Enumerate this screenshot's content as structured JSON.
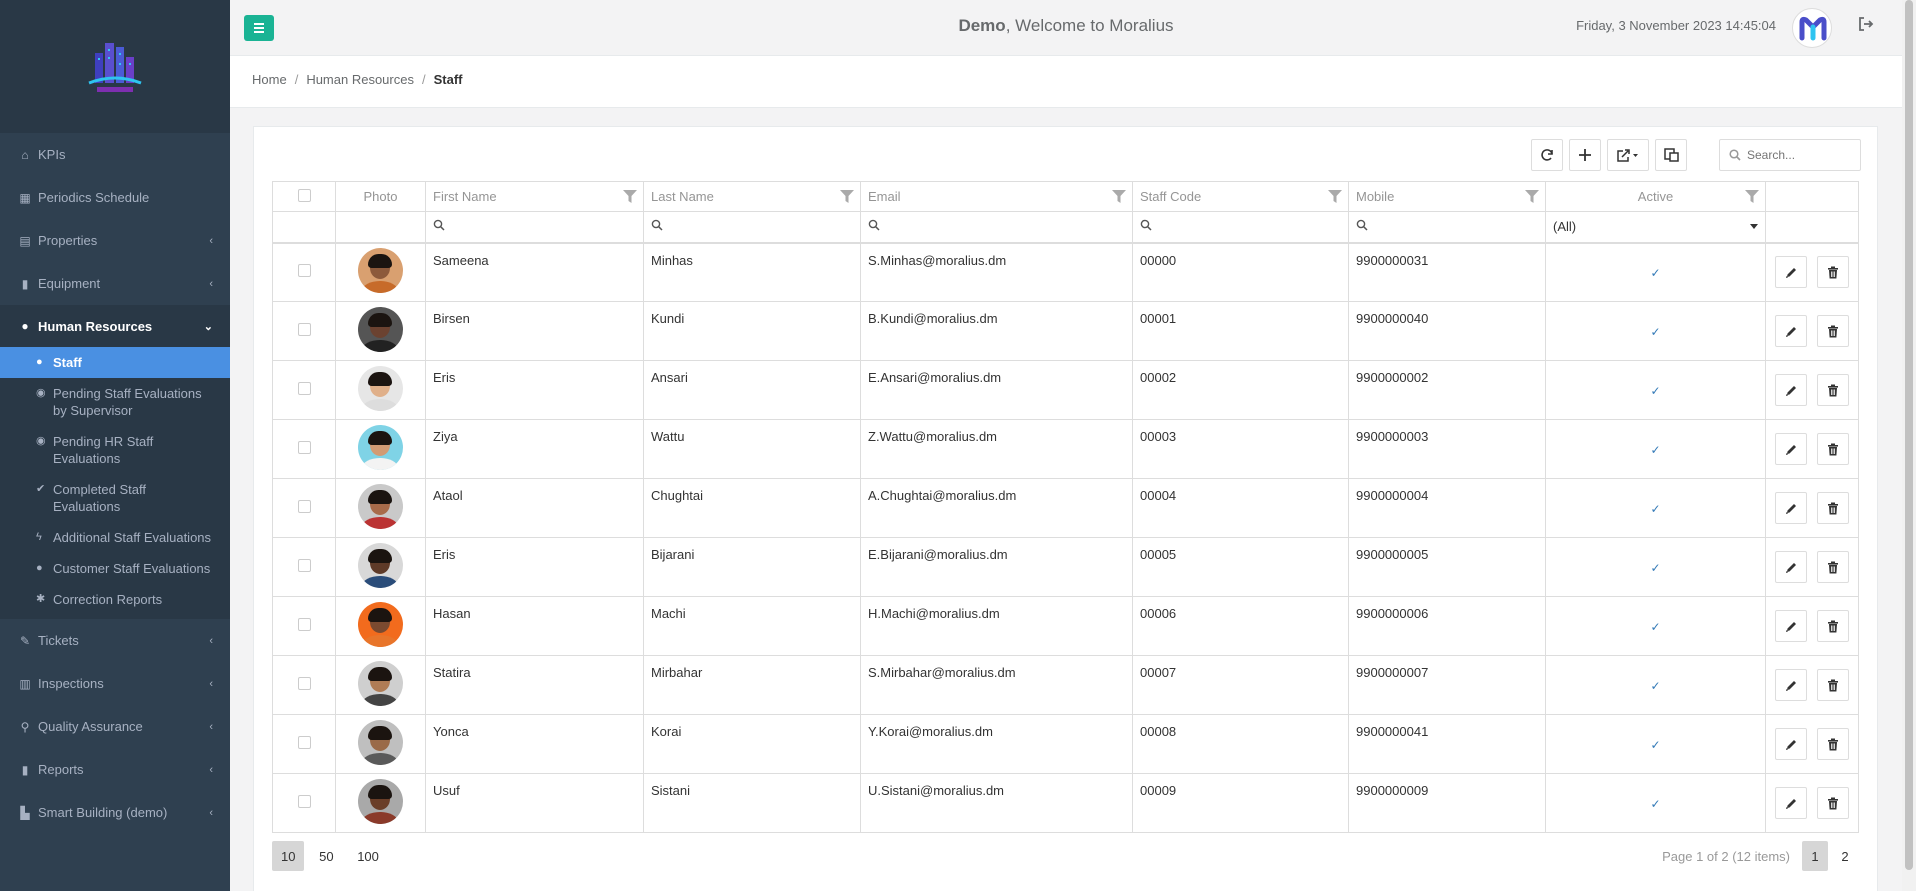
{
  "header": {
    "user": "Demo",
    "welcome_suffix": ", Welcome to Moralius",
    "datetime": "Friday, 3 November 2023 14:45:04",
    "accent_color": "#1ab394"
  },
  "breadcrumb": {
    "home": "Home",
    "section": "Human Resources",
    "current": "Staff"
  },
  "sidebar": {
    "items": [
      {
        "label": "KPIs",
        "icon": "home-icon"
      },
      {
        "label": "Periodics Schedule",
        "icon": "calendar-icon"
      },
      {
        "label": "Properties",
        "icon": "building-icon"
      },
      {
        "label": "Equipment",
        "icon": "book-icon"
      },
      {
        "label": "Human Resources",
        "icon": "users-icon"
      },
      {
        "label": "Tickets",
        "icon": "thumbtack-icon"
      },
      {
        "label": "Inspections",
        "icon": "map-icon"
      },
      {
        "label": "Quality Assurance",
        "icon": "search-icon"
      },
      {
        "label": "Reports",
        "icon": "book-icon"
      },
      {
        "label": "Smart Building (demo)",
        "icon": "bar-chart-icon"
      }
    ],
    "subitems": [
      {
        "label": "Staff",
        "icon": "users-icon"
      },
      {
        "label": "Pending Staff Evaluations by Supervisor",
        "icon": "user-circle-icon"
      },
      {
        "label": "Pending HR Staff Evaluations",
        "icon": "user-circle-icon"
      },
      {
        "label": "Completed Staff Evaluations",
        "icon": "check-icon"
      },
      {
        "label": "Additional Staff Evaluations",
        "icon": "bolt-icon"
      },
      {
        "label": "Customer Staff Evaluations",
        "icon": "users-icon"
      },
      {
        "label": "Correction Reports",
        "icon": "gear-icon"
      }
    ]
  },
  "toolbar": {
    "search_placeholder": "Search..."
  },
  "grid": {
    "columns": [
      "Photo",
      "First Name",
      "Last Name",
      "Email",
      "Staff Code",
      "Mobile",
      "Active"
    ],
    "active_filter_value": "(All)",
    "rows": [
      {
        "first": "Sameena",
        "last": "Minhas",
        "email": "S.Minhas@moralius.dm",
        "code": "00000",
        "mobile": "9900000031",
        "active": "✓"
      },
      {
        "first": "Birsen",
        "last": "Kundi",
        "email": "B.Kundi@moralius.dm",
        "code": "00001",
        "mobile": "9900000040",
        "active": "✓"
      },
      {
        "first": "Eris",
        "last": "Ansari",
        "email": "E.Ansari@moralius.dm",
        "code": "00002",
        "mobile": "9900000002",
        "active": "✓"
      },
      {
        "first": "Ziya",
        "last": "Wattu",
        "email": "Z.Wattu@moralius.dm",
        "code": "00003",
        "mobile": "9900000003",
        "active": "✓"
      },
      {
        "first": "Ataol",
        "last": "Chughtai",
        "email": "A.Chughtai@moralius.dm",
        "code": "00004",
        "mobile": "9900000004",
        "active": "✓"
      },
      {
        "first": "Eris",
        "last": "Bijarani",
        "email": "E.Bijarani@moralius.dm",
        "code": "00005",
        "mobile": "9900000005",
        "active": "✓"
      },
      {
        "first": "Hasan",
        "last": "Machi",
        "email": "H.Machi@moralius.dm",
        "code": "00006",
        "mobile": "9900000006",
        "active": "✓"
      },
      {
        "first": "Statira",
        "last": "Mirbahar",
        "email": "S.Mirbahar@moralius.dm",
        "code": "00007",
        "mobile": "9900000007",
        "active": "✓"
      },
      {
        "first": "Yonca",
        "last": "Korai",
        "email": "Y.Korai@moralius.dm",
        "code": "00008",
        "mobile": "9900000041",
        "active": "✓"
      },
      {
        "first": "Usuf",
        "last": "Sistani",
        "email": "U.Sistani@moralius.dm",
        "code": "00009",
        "mobile": "9900000009",
        "active": "✓"
      }
    ]
  },
  "pager": {
    "sizes": [
      "10",
      "50",
      "100"
    ],
    "info": "Page 1 of 2 (12 items)",
    "pages": [
      "1",
      "2"
    ]
  }
}
